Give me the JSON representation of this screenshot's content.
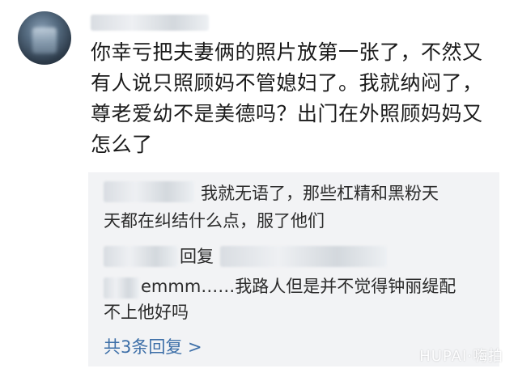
{
  "comment": {
    "lines": [
      "你幸亏把夫妻俩的照片放第一张了，不然又",
      "有人说只照顾妈不管媳妇了。我就纳闷了，",
      "尊老爱幼不是美德吗？出门在外照顾妈妈又",
      "怎么了"
    ]
  },
  "replies": {
    "reply1": {
      "line1": "我就无语了，那些杠精和黑粉天",
      "line2": "天都在纠结什么点，服了他们"
    },
    "reply2": {
      "label": "回复"
    },
    "reply3": {
      "line1": "emmm……我路人但是并不觉得钟丽缇配",
      "line2": "不上他好吗"
    },
    "more_label": "共3条回复 >"
  },
  "watermark": "HUPAI·嗨拍"
}
